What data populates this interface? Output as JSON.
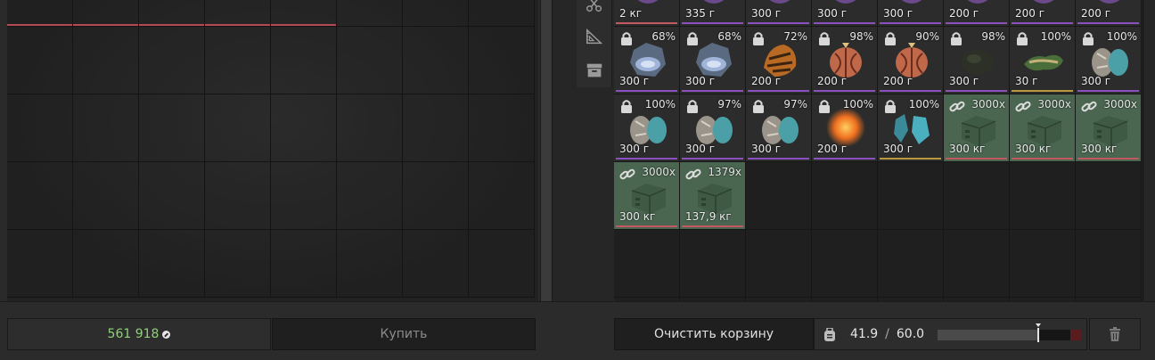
{
  "colors": {
    "money": "#8fd07a",
    "rarity_purple": "#8a4fc0",
    "rarity_pink": "#c25860",
    "rarity_yellow": "#b89a3a",
    "container_green": "#4a6650"
  },
  "sidebar_tools": [
    {
      "icon": "scissors-icon"
    },
    {
      "icon": "ruler-icon"
    },
    {
      "icon": "archive-icon"
    }
  ],
  "inventory": {
    "row0": [
      {
        "weight": "2 кг",
        "icon": "artifact-icon",
        "rarity": "pink"
      },
      {
        "weight": "335 г",
        "icon": "artifact-icon",
        "rarity": "purple"
      },
      {
        "weight": "300 г",
        "icon": "artifact-icon",
        "rarity": "purple"
      },
      {
        "weight": "300 г",
        "icon": "artifact-icon",
        "rarity": "purple"
      },
      {
        "weight": "300 г",
        "icon": "artifact-icon",
        "rarity": "purple"
      },
      {
        "weight": "200 г",
        "icon": "artifact-icon",
        "rarity": "purple"
      },
      {
        "weight": "200 г",
        "icon": "artifact-icon",
        "rarity": "purple"
      },
      {
        "weight": "200 г",
        "icon": "artifact-icon",
        "rarity": "purple"
      }
    ],
    "row1": [
      {
        "percent": "68%",
        "weight": "300 г",
        "icon": "crystal-artifact-icon",
        "locked": true,
        "rarity": "purple"
      },
      {
        "percent": "68%",
        "weight": "300 г",
        "icon": "crystal-artifact-icon",
        "locked": true,
        "rarity": "purple"
      },
      {
        "percent": "72%",
        "weight": "200 г",
        "icon": "tiger-artifact-icon",
        "locked": true,
        "rarity": "purple"
      },
      {
        "percent": "98%",
        "weight": "200 г",
        "icon": "seed-artifact-icon",
        "locked": true,
        "rarity": "purple"
      },
      {
        "percent": "90%",
        "weight": "200 г",
        "icon": "seed-artifact-icon",
        "locked": true,
        "rarity": "purple"
      },
      {
        "percent": "98%",
        "weight": "300 г",
        "icon": "dark-artifact-icon",
        "locked": true,
        "rarity": "purple"
      },
      {
        "percent": "100%",
        "weight": "30 г",
        "icon": "moss-artifact-icon",
        "locked": true,
        "rarity": "yellow"
      },
      {
        "percent": "100%",
        "weight": "300 г",
        "icon": "stone-artifact-icon",
        "locked": true,
        "rarity": "purple"
      }
    ],
    "row2": [
      {
        "percent": "100%",
        "weight": "300 г",
        "icon": "stone-artifact-icon",
        "locked": true,
        "rarity": "purple"
      },
      {
        "percent": "97%",
        "weight": "300 г",
        "icon": "stone-artifact-icon",
        "locked": true,
        "rarity": "purple"
      },
      {
        "percent": "97%",
        "weight": "300 г",
        "icon": "stone-artifact-icon",
        "locked": true,
        "rarity": "purple"
      },
      {
        "percent": "100%",
        "weight": "200 г",
        "icon": "fireball-artifact-icon",
        "locked": true,
        "rarity": "purple"
      },
      {
        "percent": "100%",
        "weight": "300 г",
        "icon": "blue-crystal-artifact-icon",
        "locked": true,
        "rarity": "yellow"
      },
      {
        "percent": "3000x",
        "weight": "300 кг",
        "icon": "ammo-box-icon",
        "linked": true,
        "rarity": "pink"
      },
      {
        "percent": "3000x",
        "weight": "300 кг",
        "icon": "ammo-box-icon",
        "linked": true,
        "rarity": "pink"
      },
      {
        "percent": "3000x",
        "weight": "300 кг",
        "icon": "ammo-box-icon",
        "linked": true,
        "rarity": "pink"
      }
    ],
    "row3": [
      {
        "percent": "3000x",
        "weight": "300 кг",
        "icon": "ammo-box-icon",
        "linked": true,
        "rarity": "pink"
      },
      {
        "percent": "1379x",
        "weight": "137,9 кг",
        "icon": "ammo-box-icon",
        "linked": true,
        "rarity": "pink"
      }
    ]
  },
  "bottom_bar": {
    "money": "561 918",
    "buy_label": "Купить",
    "clear_label": "Очистить корзину",
    "weight_current": "41.9",
    "weight_separator": "/",
    "weight_max": "60.0",
    "weight_fill_fraction": 0.698
  }
}
